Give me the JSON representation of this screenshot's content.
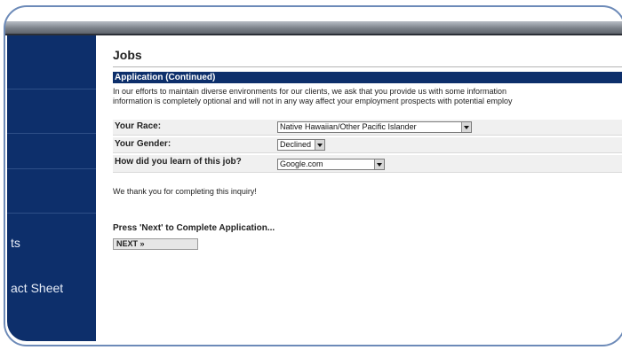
{
  "sidebar": {
    "items": [
      {
        "label": "ts"
      },
      {
        "label": "act Sheet"
      }
    ]
  },
  "page": {
    "title": "Jobs",
    "section_header": "Application (Continued)",
    "intro_line1": "In our efforts to maintain diverse environments for our clients, we ask that you provide us with some information",
    "intro_line2": "information is completely optional and will not in any way affect your employment prospects with potential employ"
  },
  "form": {
    "race": {
      "label": "Your Race:",
      "value": "Native Hawaiian/Other Pacific Islander"
    },
    "gender": {
      "label": "Your Gender:",
      "value": "Declined"
    },
    "source": {
      "label": "How did you learn of this job?",
      "value": "Google.com"
    }
  },
  "footer": {
    "thanks": "We thank you for completing this inquiry!",
    "press_next": "Press 'Next' to Complete Application...",
    "next_button": "NEXT »"
  }
}
